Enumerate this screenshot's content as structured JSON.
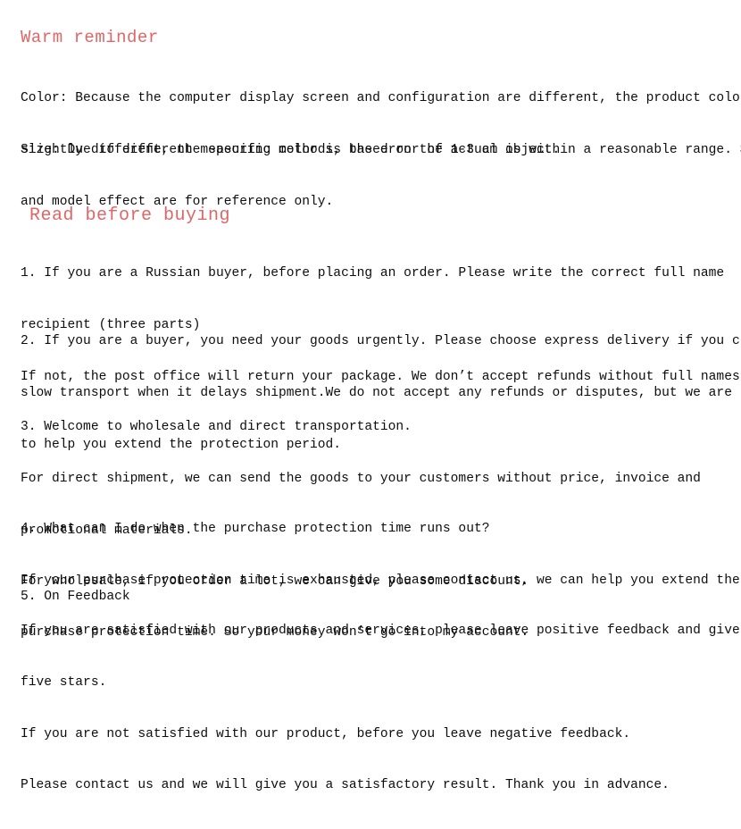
{
  "document": {
    "background_color": "#ffffff",
    "heading_color": "#e06666",
    "body_color": "#0d0d0d"
  },
  "sections": {
    "warm_reminder": {
      "heading": "Warm reminder",
      "color_paragraph": {
        "line1": "Color: Because the computer display screen and configuration are different, the product color is",
        "line2": "slightly different, the specific color is based on the actual object."
      },
      "size_paragraph": {
        "line1": "Size: Due to different measuring methods, the error of 1-3 cm is within a reasonable range. Size",
        "line2": "and model effect are for reference only."
      }
    },
    "read_before_buying": {
      "heading": "Read before buying",
      "item1": {
        "line1": "1. If you are a Russian buyer, before placing an order. Please write the correct full name",
        "line2": "recipient (three parts)",
        "line3": "If not, the post office will return your package. We don’t accept refunds without full names."
      },
      "item2": {
        "line1": "2. If you are a buyer, you need your goods urgently. Please choose express delivery if you choose",
        "line2": "slow transport when it delays shipment.We do not accept any refunds or disputes, but we are happy",
        "line3": "to help you extend the protection period."
      },
      "item3": {
        "line1": "3. Welcome to wholesale and direct transportation.",
        "line2": "For direct shipment, we can send the goods to your customers without price, invoice and",
        "line3": "promotional materials.",
        "line4": "For wholesale, if you order a lot, we can give you some discount."
      },
      "item4": {
        "line1": "4. What can I do when the purchase protection time runs out?",
        "line2": "If your purchase protection time is exhausted, please contact us, we can help you extend the",
        "line3": "purchase protection time. So your money won’t go into my account."
      },
      "item5": {
        "line1": "5. On Feedback"
      },
      "feedback": {
        "line1": "If you are satisfied with our products and services, please leave positive feedback and give us",
        "line2": "five stars.",
        "line3": "If you are not satisfied with our product, before you leave negative feedback.",
        "line4": "Please contact us and we will give you a satisfactory result. Thank you in advance."
      }
    }
  }
}
